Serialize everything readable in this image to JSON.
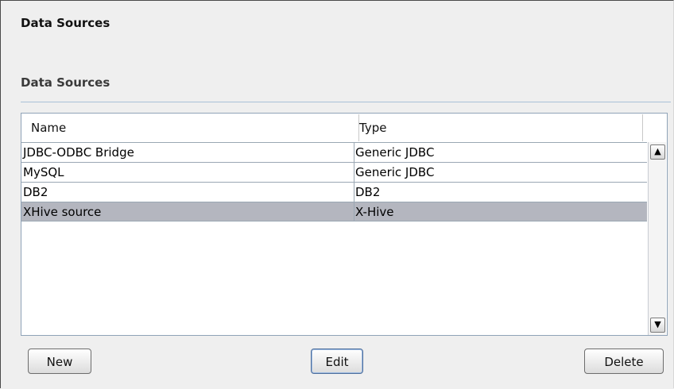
{
  "page": {
    "title": "Data Sources",
    "section_title": "Data Sources"
  },
  "table": {
    "columns": [
      "Name",
      "Type"
    ],
    "rows": [
      {
        "name": "JDBC-ODBC Bridge",
        "type": "Generic JDBC",
        "selected": false
      },
      {
        "name": "MySQL",
        "type": "Generic JDBC",
        "selected": false
      },
      {
        "name": "DB2",
        "type": "DB2",
        "selected": false
      },
      {
        "name": "XHive source",
        "type": "X-Hive",
        "selected": true
      }
    ]
  },
  "buttons": {
    "new_label": "New",
    "edit_label": "Edit",
    "delete_label": "Delete"
  },
  "icons": {
    "scroll_up": "chevron-up-icon",
    "scroll_down": "chevron-down-icon"
  },
  "colors": {
    "selected_row": "#b4b6bf",
    "table_border": "#8fa3b8"
  }
}
